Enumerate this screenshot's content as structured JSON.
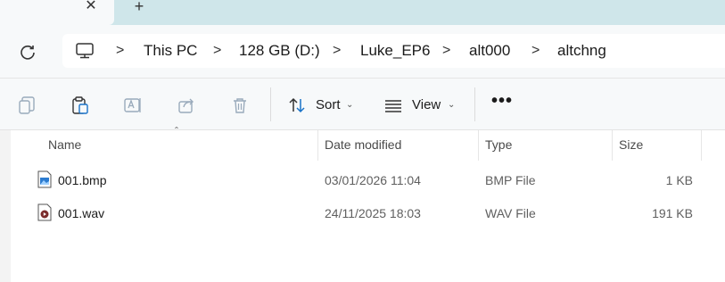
{
  "tabs": {
    "close_glyph": "✕",
    "new_tab_glyph": "+"
  },
  "address": {
    "refresh_icon": "refresh-icon",
    "location_icon": "pc-icon",
    "separator": ">",
    "crumbs": [
      "This PC",
      "128 GB (D:)",
      "Luke_EP6",
      "alt000",
      "altchng"
    ]
  },
  "toolbar": {
    "sort_label": "Sort",
    "view_label": "View",
    "more_glyph": "•••"
  },
  "columns": {
    "name": "Name",
    "date": "Date modified",
    "type": "Type",
    "size": "Size"
  },
  "files": [
    {
      "name": "001.bmp",
      "date": "03/01/2026 11:04",
      "type": "BMP File",
      "size": "1 KB",
      "icon": "bmp-file-icon"
    },
    {
      "name": "001.wav",
      "date": "24/11/2025 18:03",
      "type": "WAV File",
      "size": "191 KB",
      "icon": "wav-file-icon"
    }
  ]
}
